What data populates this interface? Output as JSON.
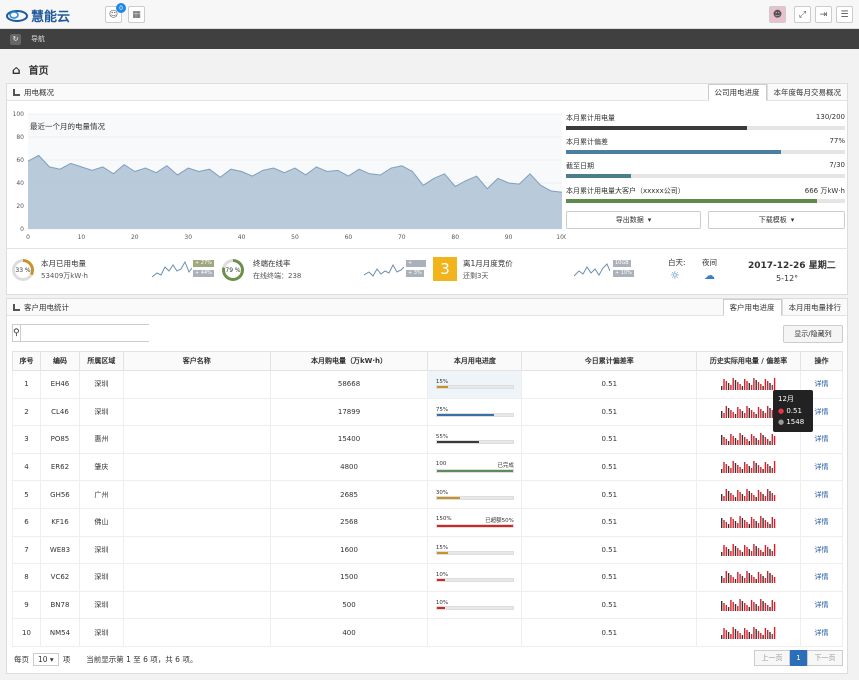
{
  "app": {
    "logo_text": "慧能云",
    "notify_count": "0"
  },
  "nav": {
    "label": "导航"
  },
  "page": {
    "title": "首页"
  },
  "overview": {
    "title": "用电概况",
    "tabs": [
      "公司用电进度",
      "本年度每月交易概况"
    ],
    "chart_title": "最近一个月的电量情况",
    "progress": [
      {
        "label": "本月累计用电量",
        "value": "130/200",
        "fraction": 0.65,
        "color": "#3a3a3a"
      },
      {
        "label": "本月累计偏差",
        "value": "77%",
        "fraction": 0.77,
        "color": "#4a7fa0"
      },
      {
        "label": "截至日期",
        "value": "7/30",
        "fraction": 0.233,
        "color": "#4a7f8a"
      },
      {
        "label": "本月累计用电量大客户（xxxxx公司）",
        "value": "666 万kW·h",
        "fraction": 0.9,
        "color": "#5e8a4a"
      }
    ],
    "export_label": "导出数据",
    "download_label": "下载模板"
  },
  "chart_data": {
    "type": "area",
    "x": [
      0,
      2,
      4,
      6,
      8,
      10,
      12,
      14,
      16,
      18,
      20,
      22,
      24,
      26,
      28,
      30,
      32,
      34,
      36,
      38,
      40,
      42,
      44,
      46,
      48,
      50,
      52,
      54,
      56,
      58,
      60,
      62,
      64,
      66,
      68,
      70,
      72,
      74,
      76,
      78,
      80,
      82,
      84,
      86,
      88,
      90,
      92,
      94,
      96,
      98,
      100
    ],
    "values": [
      59,
      64,
      54,
      52,
      57,
      54,
      51,
      54,
      48,
      56,
      50,
      53,
      49,
      55,
      47,
      53,
      50,
      52,
      45,
      52,
      50,
      46,
      51,
      53,
      49,
      53,
      47,
      54,
      50,
      51,
      46,
      52,
      48,
      47,
      53,
      55,
      50,
      38,
      44,
      48,
      37,
      42,
      46,
      35,
      44,
      40,
      39,
      48,
      38,
      33,
      32
    ],
    "xlim": [
      0,
      100
    ],
    "ylim": [
      0,
      100
    ],
    "xticks": [
      0,
      10,
      20,
      30,
      40,
      50,
      60,
      70,
      80,
      90,
      100
    ],
    "yticks": [
      0,
      20,
      40,
      60,
      80,
      100
    ],
    "color": "#9eb6cc"
  },
  "stats": [
    {
      "ring": "33 %",
      "title": "本月已用电量",
      "sub": "53409万kW·h",
      "chips": [
        "+ 27%",
        "+ 44%"
      ]
    },
    {
      "ring": "79 %",
      "title": "终端在线率",
      "sub": "在线终端：238",
      "chips": [
        "+ 76%",
        "+ 3%"
      ]
    },
    {
      "ring": "3",
      "title": "离1月月度竞价",
      "sub": "还剩3天",
      "chips": [
        "10GB",
        "+ 10%"
      ]
    }
  ],
  "weather": {
    "day": "白天:",
    "night": "夜间",
    "date": "2017-12-26 星期二",
    "temp": "5-12°"
  },
  "customers": {
    "title": "客户用电统计",
    "tabs": [
      "客户用电进度",
      "本月用电量排行"
    ],
    "toggle_label": "显示/隐藏列",
    "headers": [
      "序号",
      "编码",
      "所属区域",
      "客户名称",
      "本月购电量（万kW·h）",
      "本月用电进度",
      "今日累计偏差率",
      "历史实际用电量 / 偏差率",
      "操作"
    ],
    "rows": [
      {
        "no": "1",
        "code": "EH46",
        "area": "深圳",
        "amount": "58668",
        "pct": "15%",
        "note": "",
        "frac": 0.15,
        "color": "#c8922a",
        "dev": "0.51",
        "op": "详情"
      },
      {
        "no": "2",
        "code": "CL46",
        "area": "深圳",
        "amount": "17899",
        "pct": "75%",
        "note": "",
        "frac": 0.75,
        "color": "#3a6fa8",
        "dev": "0.51",
        "op": "详情"
      },
      {
        "no": "3",
        "code": "PO85",
        "area": "惠州",
        "amount": "15400",
        "pct": "55%",
        "note": "",
        "frac": 0.55,
        "color": "#3a3a3a",
        "dev": "0.51",
        "op": "详情"
      },
      {
        "no": "4",
        "code": "ER62",
        "area": "肇庆",
        "amount": "4800",
        "pct": "100",
        "note": "已完成",
        "frac": 1.0,
        "color": "#5e8a5e",
        "dev": "0.51",
        "op": "详情"
      },
      {
        "no": "5",
        "code": "GH56",
        "area": "广州",
        "amount": "2685",
        "pct": "30%",
        "note": "",
        "frac": 0.3,
        "color": "#c8922a",
        "dev": "0.51",
        "op": "详情"
      },
      {
        "no": "6",
        "code": "KF16",
        "area": "佛山",
        "amount": "2568",
        "pct": "150%",
        "note": "已超额50%",
        "frac": 1.0,
        "color": "#d62424",
        "dev": "0.51",
        "op": "详情"
      },
      {
        "no": "7",
        "code": "WE83",
        "area": "深圳",
        "amount": "1600",
        "pct": "15%",
        "note": "",
        "frac": 0.15,
        "color": "#c8922a",
        "dev": "0.51",
        "op": "详情"
      },
      {
        "no": "8",
        "code": "VC62",
        "area": "深圳",
        "amount": "1500",
        "pct": "10%",
        "note": "",
        "frac": 0.1,
        "color": "#d62424",
        "dev": "0.51",
        "op": "详情"
      },
      {
        "no": "9",
        "code": "BN78",
        "area": "深圳",
        "amount": "500",
        "pct": "10%",
        "note": "",
        "frac": 0.1,
        "color": "#d62424",
        "dev": "0.51",
        "op": "详情"
      },
      {
        "no": "10",
        "code": "NM54",
        "area": "深圳",
        "amount": "400",
        "pct": "",
        "note": "",
        "frac": 0,
        "color": "#d62424",
        "dev": "0.51",
        "op": "详情"
      }
    ],
    "tooltip": {
      "title": "12月",
      "v1": "0.51",
      "v2": "1548"
    },
    "footer": {
      "per_page": "每页",
      "per_page_value": "10",
      "unit": "项",
      "info": "当前显示第 1 至 6 项，共 6 项。",
      "prev": "上一页",
      "page": "1",
      "next": "下一页"
    }
  }
}
